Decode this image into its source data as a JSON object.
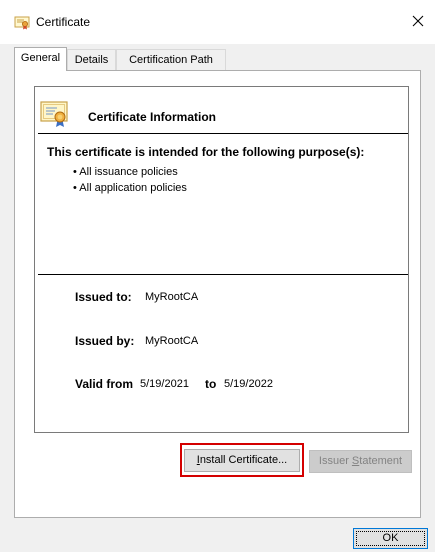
{
  "window": {
    "title": "Certificate",
    "close_glyph": "✕"
  },
  "tabs": [
    {
      "label": "General",
      "active": true
    },
    {
      "label": "Details",
      "active": false
    },
    {
      "label": "Certification Path",
      "active": false
    }
  ],
  "info": {
    "heading": "Certificate Information",
    "purpose_heading": "This certificate is intended for the following purpose(s):",
    "policies": [
      "• All issuance policies",
      "• All application policies"
    ]
  },
  "fields": {
    "issued_to_label": "Issued to:",
    "issued_to_value": "MyRootCA",
    "issued_by_label": "Issued by:",
    "issued_by_value": "MyRootCA",
    "valid_from_label": "Valid from",
    "valid_from_value": "5/19/2021",
    "to_label": "to",
    "valid_to_value": "5/19/2022"
  },
  "buttons": {
    "install_prefix": "",
    "install_underline": "I",
    "install_rest": "nstall Certificate...",
    "issuer_prefix": "Issuer ",
    "issuer_underline": "S",
    "issuer_rest": "tatement",
    "ok": "OK"
  },
  "colors": {
    "highlight": "#d40000",
    "accent": "#0078d7"
  },
  "icons": {
    "title": "certificate-icon",
    "info": "certificate-icon",
    "close": "close-icon"
  }
}
